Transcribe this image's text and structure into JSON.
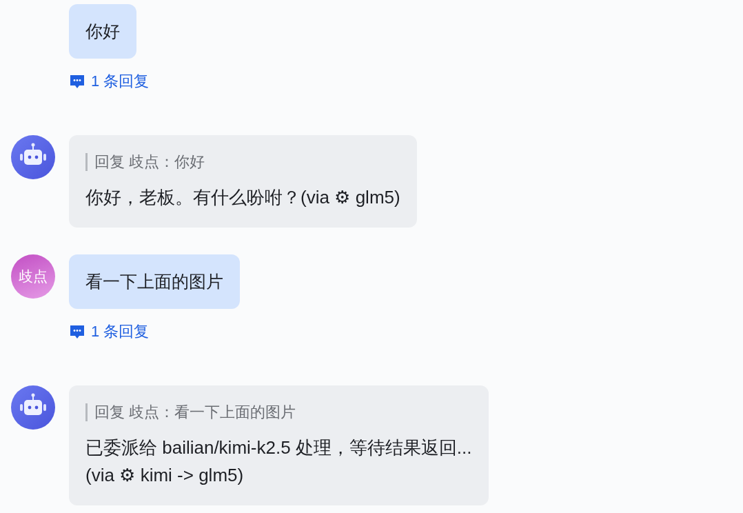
{
  "messages": [
    {
      "kind": "user",
      "text": "你好",
      "replies": "1 条回复"
    },
    {
      "kind": "bot",
      "quote": "回复 歧点：你好",
      "text": "你好，老板。有什么吩咐？(via ⚙ glm5)"
    },
    {
      "kind": "user",
      "avatar": "歧点",
      "text": "看一下上面的图片",
      "replies": "1 条回复"
    },
    {
      "kind": "bot",
      "quote": "回复 歧点：看一下上面的图片",
      "text": "已委派给 bailian/kimi-k2.5 处理，等待结果返回...\n(via ⚙ kimi -> glm5)"
    }
  ]
}
